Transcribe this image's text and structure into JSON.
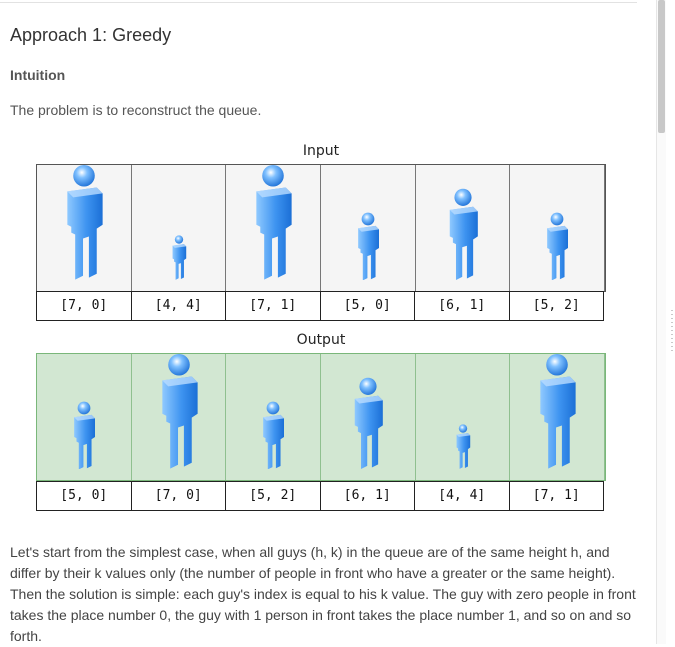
{
  "article": {
    "heading": "Approach 1: Greedy",
    "subheading": "Intuition",
    "intro": "The problem is to reconstruct the queue.",
    "paragraph": "Let's start from the simplest case, when all guys (h, k) in the queue are of the same height h, and differ by their k values only (the number of people in front who have a greater or the same height). Then the solution is simple: each guy's index is equal to his k value. The guy with zero people in front takes the place number 0, the guy with 1 person in front takes the place number 1, and so on and so forth."
  },
  "figure": {
    "input_caption": "Input",
    "output_caption": "Output",
    "input": [
      {
        "label": "[7, 0]",
        "h": 7
      },
      {
        "label": "[4, 4]",
        "h": 4
      },
      {
        "label": "[7, 1]",
        "h": 7
      },
      {
        "label": "[5, 0]",
        "h": 5
      },
      {
        "label": "[6, 1]",
        "h": 6
      },
      {
        "label": "[5, 2]",
        "h": 5
      }
    ],
    "output": [
      {
        "label": "[5, 0]",
        "h": 5
      },
      {
        "label": "[7, 0]",
        "h": 7
      },
      {
        "label": "[5, 2]",
        "h": 5
      },
      {
        "label": "[6, 1]",
        "h": 6
      },
      {
        "label": "[4, 4]",
        "h": 4
      },
      {
        "label": "[7, 1]",
        "h": 7
      }
    ],
    "colors": {
      "input_bg": "#f5f5f5",
      "output_bg": "#d2e7d2",
      "person_light": "#8fc9ff",
      "person_dark": "#1b6fd6"
    }
  }
}
